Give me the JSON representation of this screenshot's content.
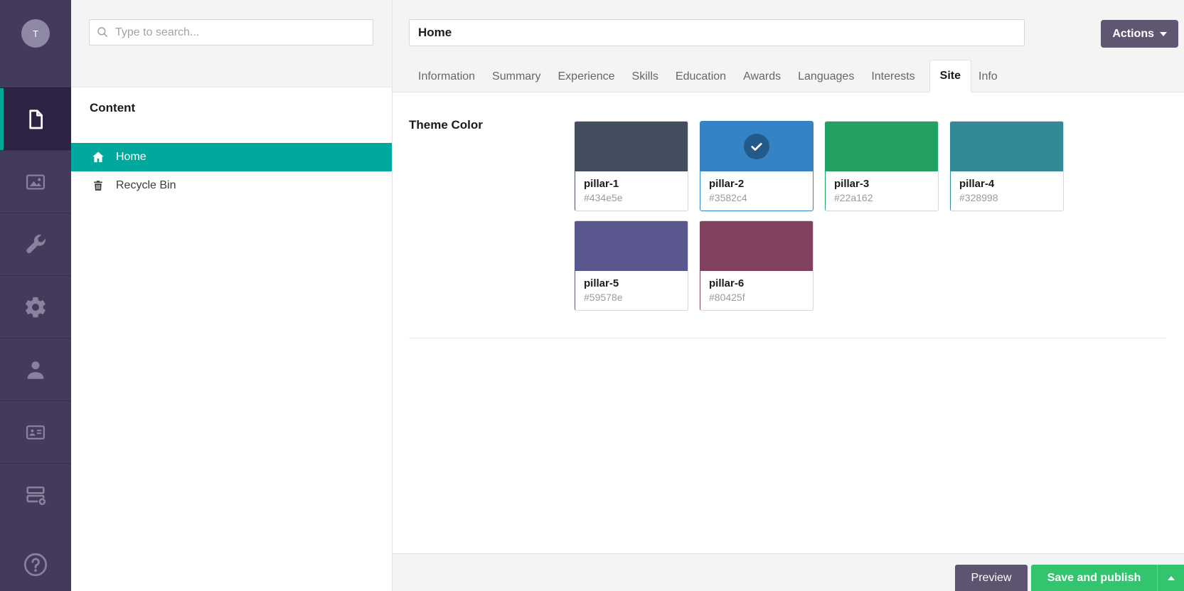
{
  "colors": {
    "accent_teal": "#00a89e",
    "sidebar_bg": "#443a5c",
    "sidebar_active_bg": "#2e2345",
    "header_gray": "#f4f4f5",
    "button_purple": "#5f5671",
    "preview_purple": "#5d5470",
    "save_green": "#32c56e",
    "check_circle": "#2a5a86"
  },
  "sidebar": {
    "avatar_letter": "T",
    "items": [
      {
        "icon": "document-icon",
        "active": true
      },
      {
        "icon": "media-icon",
        "active": false
      },
      {
        "icon": "wrench-icon",
        "active": false
      },
      {
        "icon": "gear-icon",
        "active": false
      },
      {
        "icon": "user-icon",
        "active": false
      },
      {
        "icon": "id-card-icon",
        "active": false
      },
      {
        "icon": "forms-icon",
        "active": false
      }
    ],
    "help_icon": "help-icon"
  },
  "tree": {
    "search_placeholder": "Type to search...",
    "section_header": "Content",
    "nodes": [
      {
        "label": "Home",
        "icon": "home-icon",
        "selected": true
      },
      {
        "label": "Recycle Bin",
        "icon": "trash-icon",
        "selected": false
      }
    ]
  },
  "editor": {
    "title_value": "Home",
    "actions_button": "Actions",
    "tabs": [
      {
        "label": "Information",
        "active": false
      },
      {
        "label": "Summary",
        "active": false
      },
      {
        "label": "Experience",
        "active": false
      },
      {
        "label": "Skills",
        "active": false
      },
      {
        "label": "Education",
        "active": false
      },
      {
        "label": "Awards",
        "active": false
      },
      {
        "label": "Languages",
        "active": false
      },
      {
        "label": "Interests",
        "active": false
      },
      {
        "label": "Site",
        "active": true
      },
      {
        "label": "Info",
        "active": false
      }
    ],
    "property_label": "Theme Color",
    "swatches": [
      {
        "name": "pillar-1",
        "hex": "#434e5e",
        "selected": false
      },
      {
        "name": "pillar-2",
        "hex": "#3582c4",
        "selected": true
      },
      {
        "name": "pillar-3",
        "hex": "#22a162",
        "selected": false
      },
      {
        "name": "pillar-4",
        "hex": "#328998",
        "selected": false
      },
      {
        "name": "pillar-5",
        "hex": "#59578e",
        "selected": false
      },
      {
        "name": "pillar-6",
        "hex": "#80425f",
        "selected": false
      }
    ]
  },
  "footer": {
    "preview_button": "Preview",
    "save_button": "Save and publish"
  }
}
